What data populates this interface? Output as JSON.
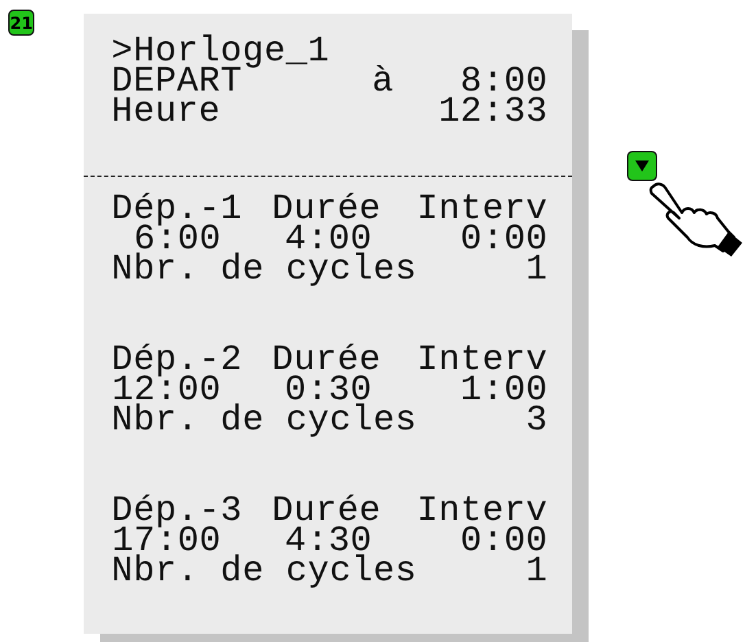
{
  "screen_number": "21",
  "title": ">Horloge_1",
  "start": {
    "label": "DEPART",
    "at": "à",
    "time": "8:00"
  },
  "clock": {
    "label": "Heure",
    "time": "12:33"
  },
  "programs": [
    {
      "name": "Dép.-1",
      "duration_label": "Durée",
      "interval_label": "Interv",
      "start": "6:00",
      "duration": "4:00",
      "interval": "0:00",
      "cycles_label": "Nbr. de cycles",
      "cycles": "1"
    },
    {
      "name": "Dép.-2",
      "duration_label": "Durée",
      "interval_label": "Interv",
      "start": "12:00",
      "duration": "0:30",
      "interval": "1:00",
      "cycles_label": "Nbr. de cycles",
      "cycles": "3"
    },
    {
      "name": "Dép.-3",
      "duration_label": "Durée",
      "interval_label": "Interv",
      "start": "17:00",
      "duration": "4:30",
      "interval": "0:00",
      "cycles_label": "Nbr. de cycles",
      "cycles": "1"
    }
  ]
}
